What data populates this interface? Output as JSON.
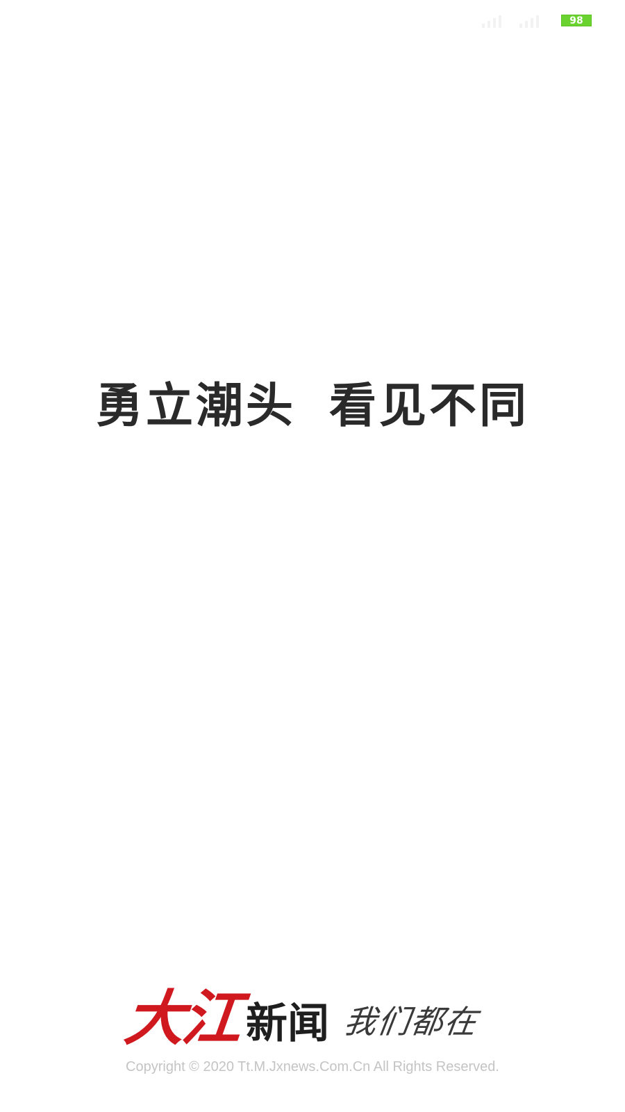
{
  "status_bar": {
    "battery_level": "98",
    "battery_color": "#6bd32f",
    "signal_icons": [
      "signal-bars-icon",
      "signal-bars-icon"
    ]
  },
  "splash": {
    "slogan_part1": "勇立潮头",
    "slogan_part2": "看见不同"
  },
  "footer": {
    "brand_logo": "大江",
    "brand_news": "新闻",
    "brand_tagline": "我们都在",
    "brand_color": "#d0181f",
    "copyright": "Copyright © 2020 Tt.M.Jxnews.Com.Cn All Rights Reserved."
  }
}
